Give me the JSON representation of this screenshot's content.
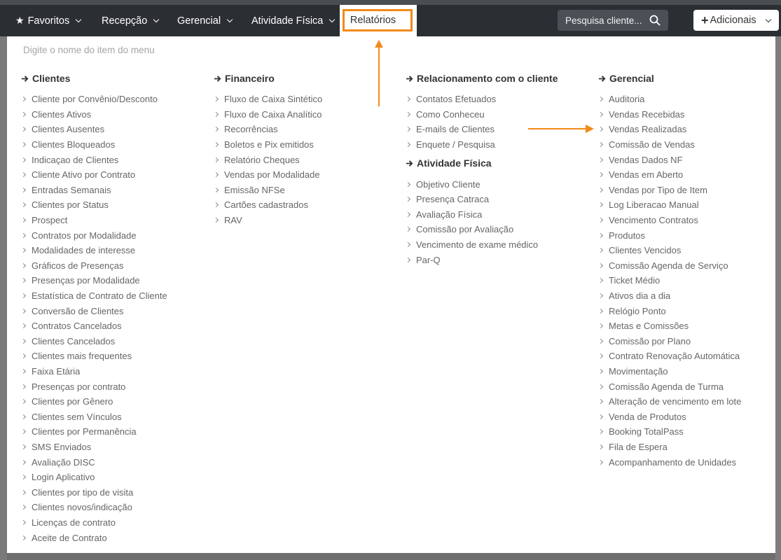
{
  "nav": {
    "favoritos": "Favoritos",
    "recepcao": "Recepção",
    "gerencial": "Gerencial",
    "atividade": "Atividade Física",
    "relatorios": "Relatórios",
    "search_placeholder": "Pesquisa cliente...",
    "add_label": "Adicionais"
  },
  "menu": {
    "filter_placeholder": "Digite o nome do item do menu",
    "clientes": {
      "title": "Clientes",
      "items": [
        "Cliente por Convênio/Desconto",
        "Clientes Ativos",
        "Clientes Ausentes",
        "Clientes Bloqueados",
        "Indicaçao de Clientes",
        "Cliente Ativo por Contrato",
        "Entradas Semanais",
        "Clientes por Status",
        "Prospect",
        "Contratos por Modalidade",
        "Modalidades de interesse",
        "Gráficos de Presenças",
        "Presenças por Modalidade",
        "Estatística de Contrato de Cliente",
        "Conversão de Clientes",
        "Contratos Cancelados",
        "Clientes Cancelados",
        "Clientes mais frequentes",
        "Faixa Etária",
        "Presenças por contrato",
        "Clientes por Gênero",
        "Clientes sem Vínculos",
        "Clientes por Permanência",
        "SMS Enviados",
        "Avaliação DISC",
        "Login Aplicativo",
        "Clientes por tipo de visita",
        "Clientes novos/indicação",
        "Licenças de contrato",
        "Aceite de Contrato"
      ]
    },
    "financeiro": {
      "title": "Financeiro",
      "items": [
        "Fluxo de Caixa Sintético",
        "Fluxo de Caixa Analítico",
        "Recorrências",
        "Boletos e Pix emitidos",
        "Relatório Cheques",
        "Vendas por Modalidade",
        "Emissão NFSe",
        "Cartões cadastrados",
        "RAV"
      ]
    },
    "relacionamento": {
      "title": "Relacionamento com o cliente",
      "items": [
        "Contatos Efetuados",
        "Como Conheceu",
        "E-mails de Clientes",
        "Enquete / Pesquisa"
      ]
    },
    "atividade": {
      "title": "Atividade Física",
      "items": [
        "Objetivo Cliente",
        "Presença Catraca",
        "Avaliação Física",
        "Comissão por Avaliação",
        "Vencimento de exame médico",
        "Par-Q"
      ]
    },
    "gerencial": {
      "title": "Gerencial",
      "items": [
        "Auditoria",
        "Vendas Recebidas",
        "Vendas Realizadas",
        "Comissão de Vendas",
        "Vendas Dados NF",
        "Vendas em Aberto",
        "Vendas por Tipo de Item",
        "Log Liberacao Manual",
        "Vencimento Contratos",
        "Produtos",
        "Clientes Vencidos",
        "Comissão Agenda de Serviço",
        "Ticket Médio",
        "Ativos dia a dia",
        "Relógio Ponto",
        "Metas e Comissões",
        "Comissão por Plano",
        "Contrato Renovação Automática",
        "Movimentação",
        "Comissão Agenda de Turma",
        "Alteração de vencimento em lote",
        "Venda de Produtos",
        "Booking TotalPass",
        "Fila de Espera",
        "Acompanhamento de Unidades"
      ]
    }
  },
  "colors": {
    "accent": "#f28a1a",
    "navbar": "#2b2f33"
  }
}
